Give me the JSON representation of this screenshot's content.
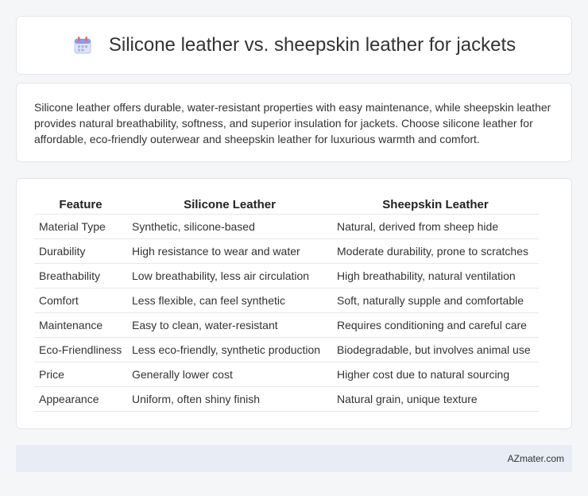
{
  "header": {
    "title": "Silicone leather vs. sheepskin leather for jackets",
    "icon": "calendar-icon"
  },
  "summary": {
    "text": "Silicone leather offers durable, water-resistant properties with easy maintenance, while sheepskin leather provides natural breathability, softness, and superior insulation for jackets. Choose silicone leather for affordable, eco-friendly outerwear and sheepskin leather for luxurious warmth and comfort."
  },
  "table": {
    "headers": [
      "Feature",
      "Silicone Leather",
      "Sheepskin Leather"
    ],
    "rows": [
      [
        "Material Type",
        "Synthetic, silicone-based",
        "Natural, derived from sheep hide"
      ],
      [
        "Durability",
        "High resistance to wear and water",
        "Moderate durability, prone to scratches"
      ],
      [
        "Breathability",
        "Low breathability, less air circulation",
        "High breathability, natural ventilation"
      ],
      [
        "Comfort",
        "Less flexible, can feel synthetic",
        "Soft, naturally supple and comfortable"
      ],
      [
        "Maintenance",
        "Easy to clean, water-resistant",
        "Requires conditioning and careful care"
      ],
      [
        "Eco-Friendliness",
        "Less eco-friendly, synthetic production",
        "Biodegradable, but involves animal use"
      ],
      [
        "Price",
        "Generally lower cost",
        "Higher cost due to natural sourcing"
      ],
      [
        "Appearance",
        "Uniform, often shiny finish",
        "Natural grain, unique texture"
      ]
    ]
  },
  "footer": {
    "brand": "AZmater.com"
  }
}
